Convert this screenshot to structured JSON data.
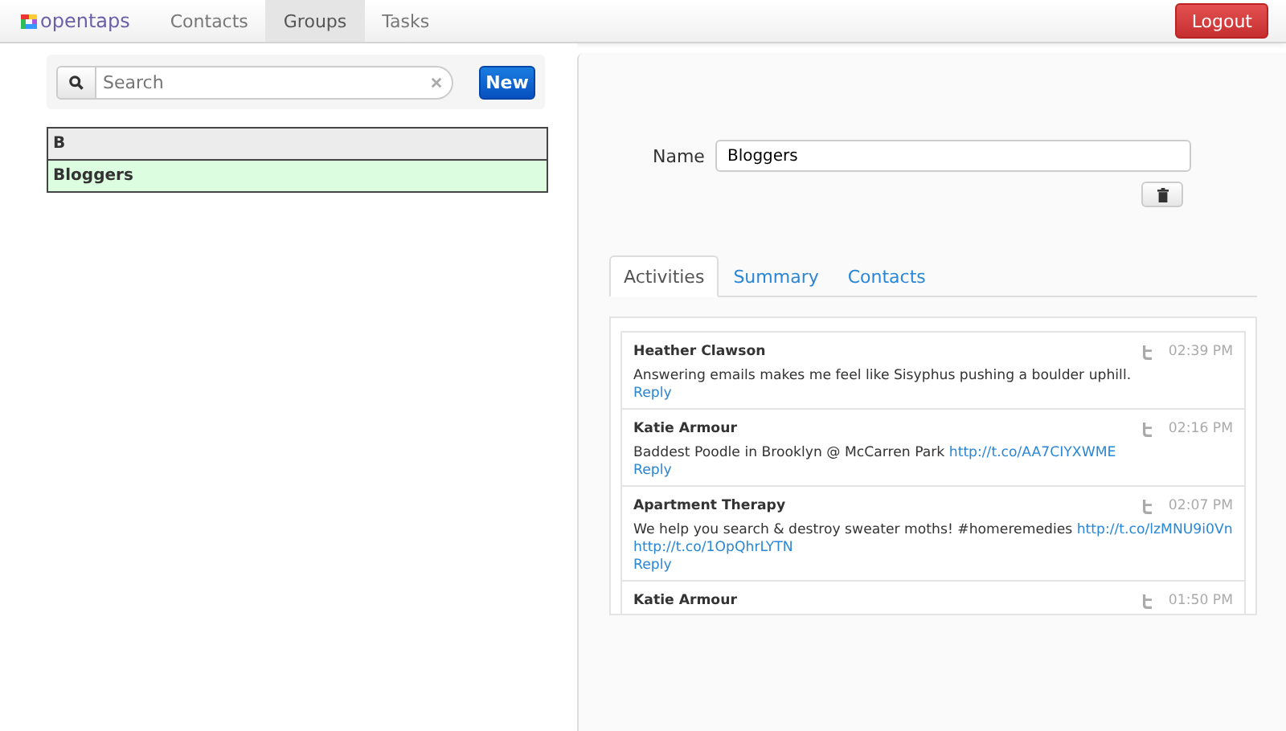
{
  "nav": {
    "logo": "opentaps",
    "tabs": [
      {
        "label": "Contacts",
        "selected": false
      },
      {
        "label": "Groups",
        "selected": true
      },
      {
        "label": "Tasks",
        "selected": false
      }
    ],
    "logout": "Logout"
  },
  "sidebar": {
    "search": {
      "placeholder": "Search"
    },
    "new_button": "New",
    "groups": [
      {
        "kind": "header",
        "label": "B",
        "selected": false
      },
      {
        "kind": "item",
        "label": "Bloggers",
        "selected": true
      }
    ]
  },
  "detail": {
    "name_label": "Name",
    "name_value": "Bloggers",
    "tabs": [
      {
        "label": "Activities",
        "selected": true
      },
      {
        "label": "Summary",
        "selected": false
      },
      {
        "label": "Contacts",
        "selected": false
      }
    ],
    "activities": [
      {
        "author": "Heather Clawson",
        "time": "02:39 PM",
        "text": "Answering emails makes me feel like Sisyphus pushing a boulder uphill.",
        "reply": "Reply"
      },
      {
        "author": "Katie Armour",
        "time": "02:16 PM",
        "text": "Baddest Poodle in Brooklyn @ McCarren Park",
        "links": [
          "http://t.co/AA7CIYXWME"
        ],
        "reply": "Reply"
      },
      {
        "author": "Apartment Therapy",
        "time": "02:07 PM",
        "text": "We help you search & destroy sweater moths! #homeremedies",
        "links": [
          "http://t.co/lzMNU9i0Vn",
          "http://t.co/1OpQhrLYTN"
        ],
        "reply": "Reply"
      },
      {
        "author": "Katie Armour",
        "time": "01:50 PM"
      }
    ]
  }
}
